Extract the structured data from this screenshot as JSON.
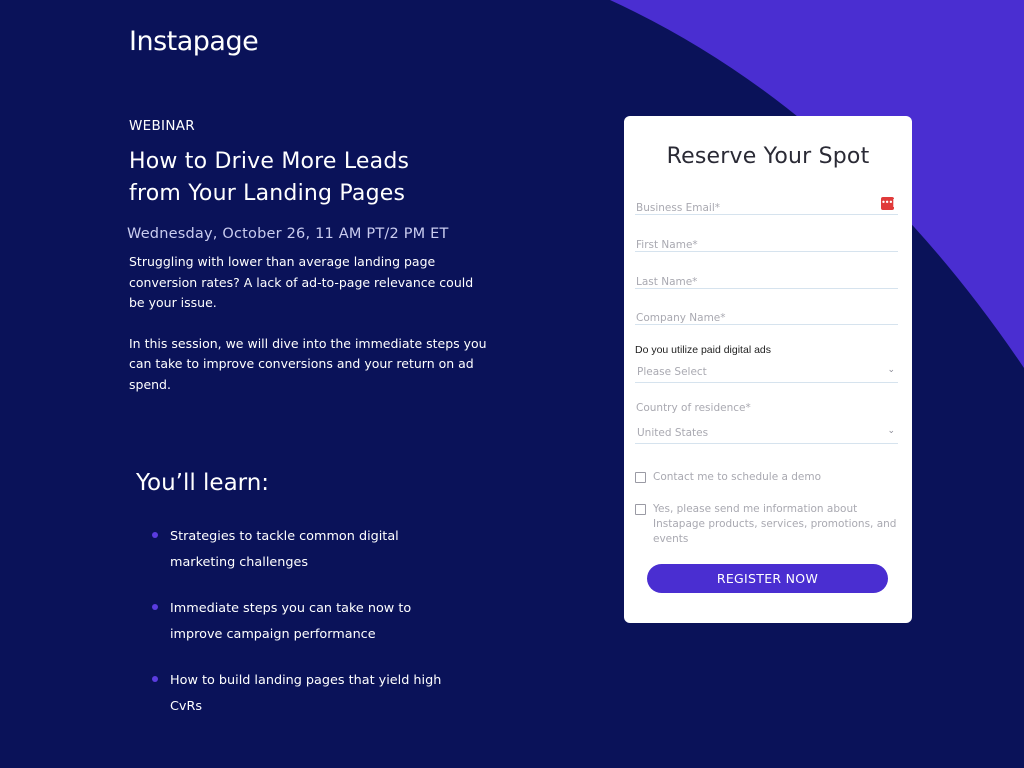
{
  "colors": {
    "background": "#0a1259",
    "accent_arc": "#4a2ed1",
    "button": "#4a2ed1",
    "bullet": "#5b3ce0",
    "password_manager_icon": "#e03a3a"
  },
  "logo": {
    "text": "Instapage"
  },
  "hero": {
    "eyebrow": "WEBINAR",
    "headline_line1": "How to Drive More Leads",
    "headline_line2": "from Your Landing Pages",
    "date": "Wednesday, October 26, 11 AM PT/2 PM ET",
    "paragraphs": [
      "Struggling with lower than average landing page conversion rates? A lack of ad-to-page relevance could be your issue.",
      "In this session, we will dive into the immediate steps you can take to improve conversions and your return on ad spend."
    ]
  },
  "learn": {
    "title": "You’ll learn:",
    "items": [
      "Strategies to tackle common digital marketing challenges",
      "Immediate steps you can take now to improve campaign performance",
      "How to build landing pages that yield high CvRs"
    ]
  },
  "form": {
    "title": "Reserve Your Spot",
    "fields": {
      "email": {
        "placeholder": "Business Email*",
        "value": ""
      },
      "first_name": {
        "placeholder": "First Name*",
        "value": ""
      },
      "last_name": {
        "placeholder": "Last Name*",
        "value": ""
      },
      "company": {
        "placeholder": "Company Name*",
        "value": ""
      }
    },
    "password_manager_icon": "•••|",
    "paid_ads": {
      "label": "Do you utilize paid digital ads",
      "selected": "Please Select"
    },
    "country": {
      "label": "Country of residence*",
      "selected": "United States"
    },
    "chevron": "⌄",
    "checkboxes": [
      {
        "label": "Contact me to schedule a demo",
        "checked": false
      },
      {
        "label": "Yes, please send me information about Instapage products, services, promotions, and events",
        "checked": false
      }
    ],
    "submit_label": "REGISTER NOW"
  }
}
